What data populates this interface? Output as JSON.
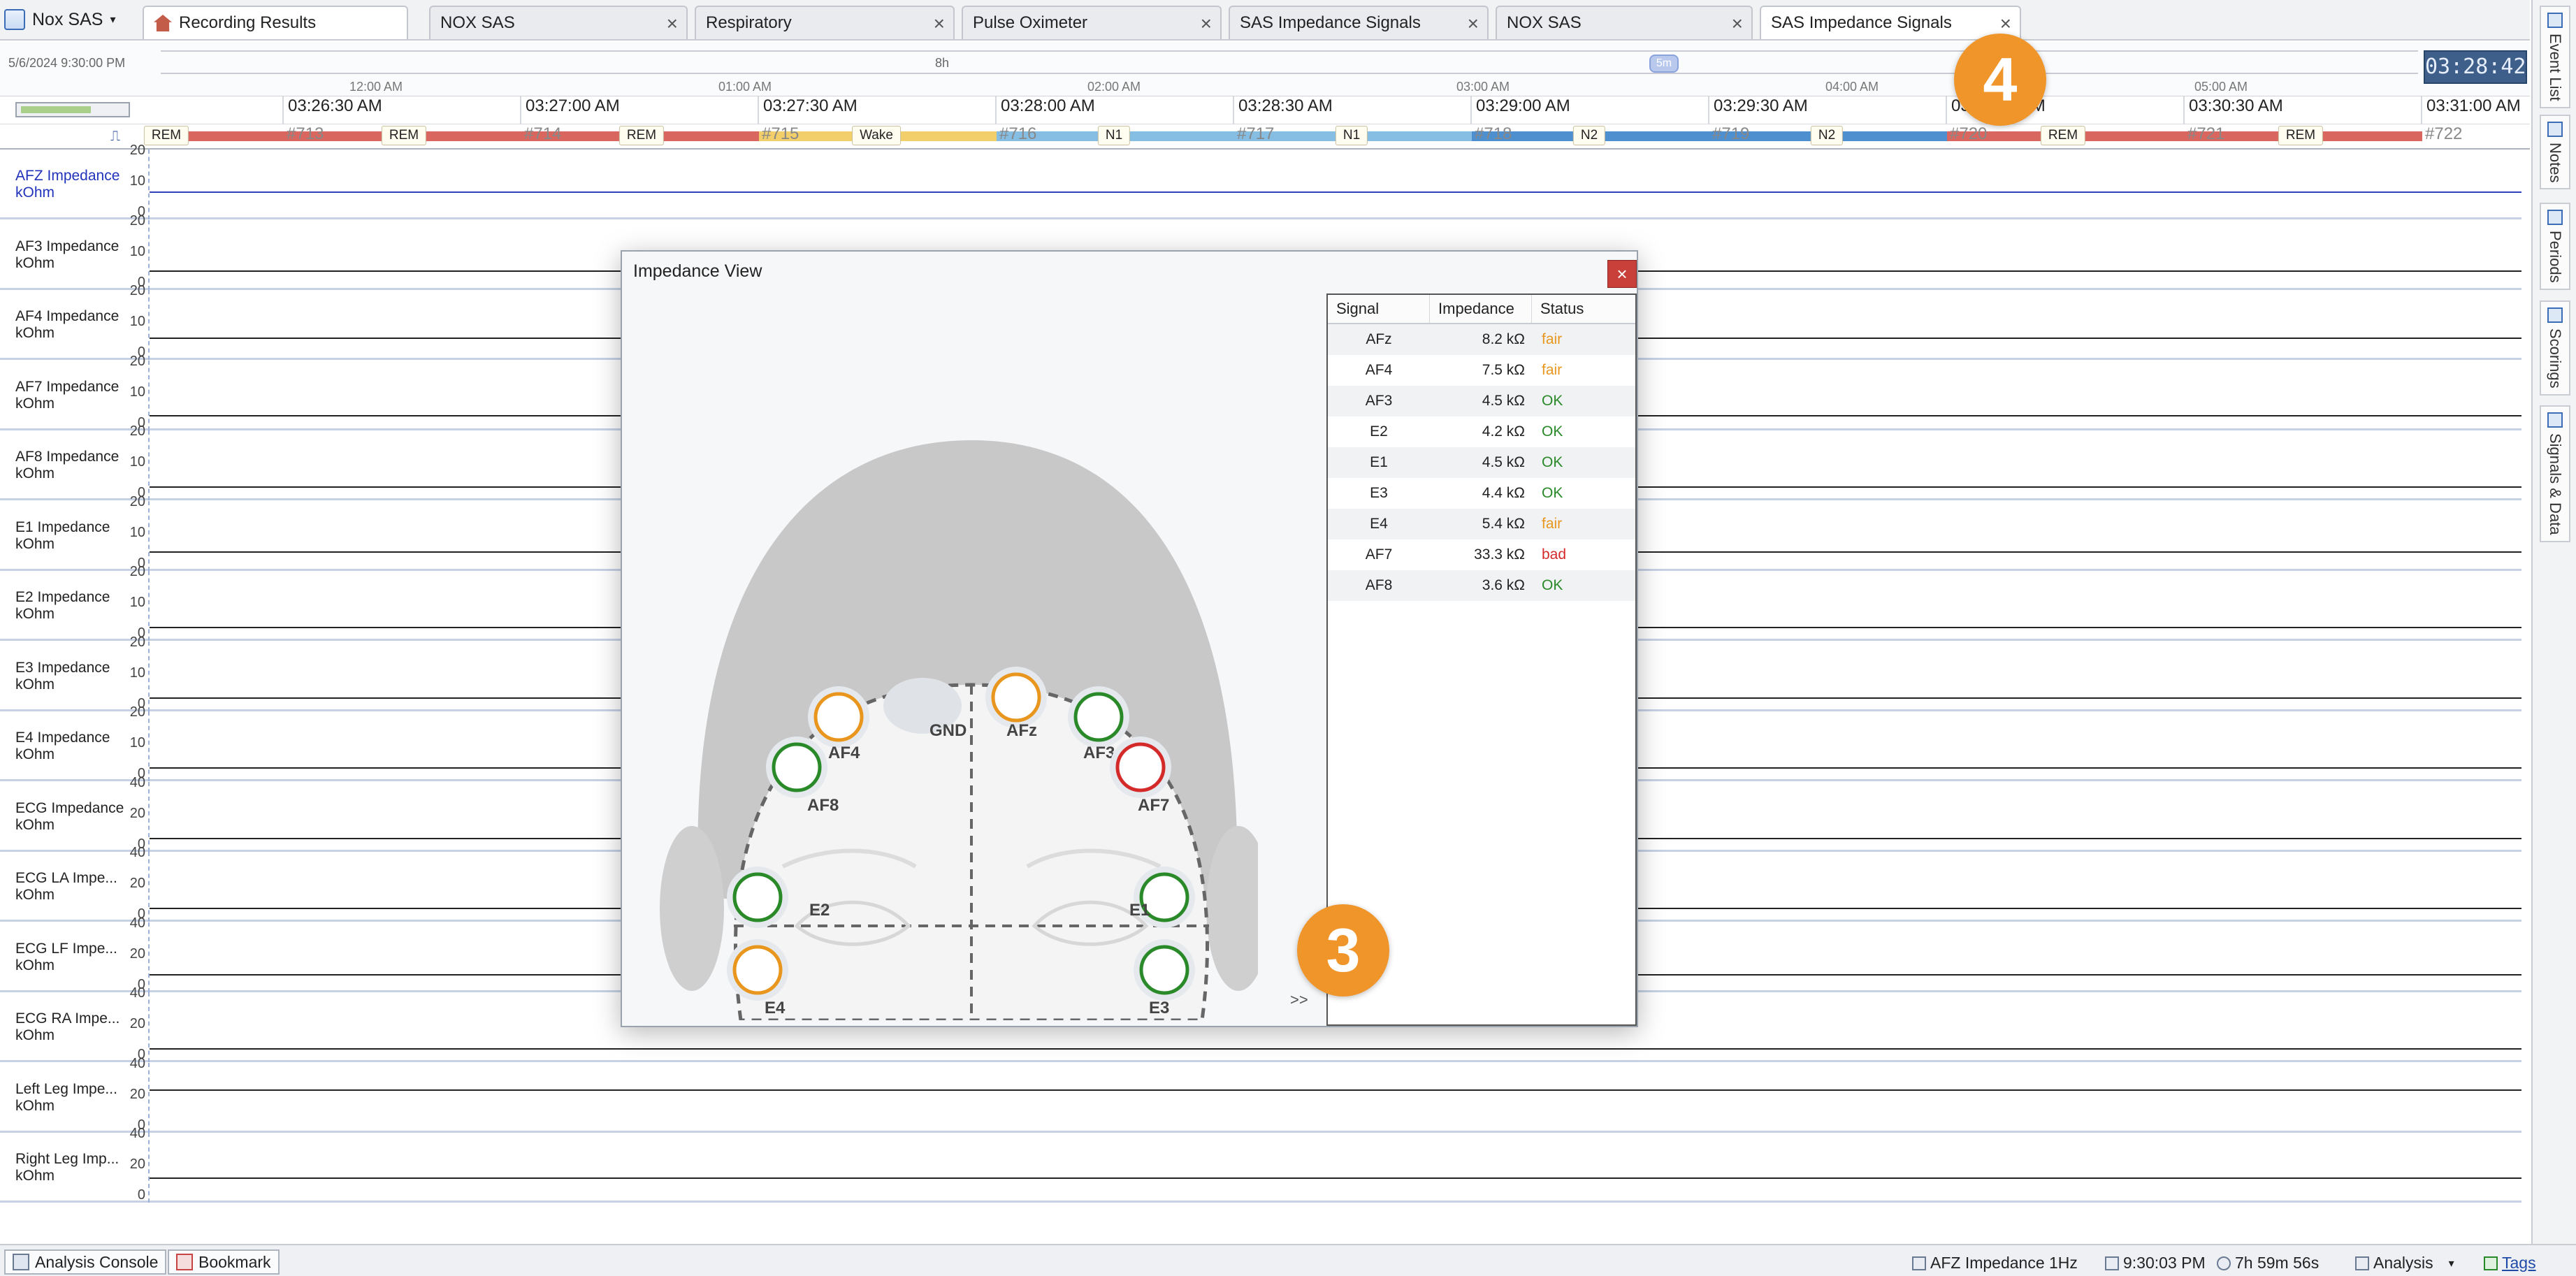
{
  "app": {
    "name": "Nox SAS"
  },
  "tabs": [
    {
      "label": "Recording Results",
      "active": true,
      "closable": false
    },
    {
      "label": "NOX SAS",
      "closable": true
    },
    {
      "label": "Respiratory",
      "closable": true
    },
    {
      "label": "Pulse Oximeter",
      "closable": true
    },
    {
      "label": "SAS Impedance Signals",
      "closable": true
    },
    {
      "label": "NOX SAS",
      "closable": true
    },
    {
      "label": "SAS Impedance Signals",
      "closable": true,
      "active_second": true
    }
  ],
  "overview": {
    "start_datetime": "5/6/2024 9:30:00 PM",
    "duration_label": "8h",
    "window_label": "5m",
    "clock": "03:28:42",
    "ticks": [
      "12:00 AM",
      "01:00 AM",
      "02:00 AM",
      "03:00 AM",
      "04:00 AM",
      "05:00 AM"
    ]
  },
  "time_axis": [
    "03:26:30 AM",
    "03:27:00 AM",
    "03:27:30 AM",
    "03:28:00 AM",
    "03:28:30 AM",
    "03:29:00 AM",
    "03:29:30 AM",
    "03:30:00 AM",
    "03:30:30 AM",
    "03:31:00 AM"
  ],
  "hypnogram": {
    "stages": [
      "REM",
      "REM",
      "REM",
      "Wake",
      "N1",
      "N1",
      "N2",
      "N2",
      "REM",
      "REM"
    ],
    "epochs": [
      "#713",
      "#714",
      "#715",
      "#716",
      "#717",
      "#718",
      "#719",
      "#720",
      "#721",
      "#722"
    ],
    "colors": {
      "REM": "#d9675f",
      "Wake": "#f2cf6b",
      "N1": "#86bde3",
      "N2": "#4d8fcf"
    }
  },
  "channels": [
    {
      "label": "AFZ Impedance kOhm",
      "scale": [
        "20",
        "10",
        "0"
      ],
      "selected": true
    },
    {
      "label": "AF3 Impedance kOhm",
      "scale": [
        "20",
        "10",
        "0"
      ]
    },
    {
      "label": "AF4 Impedance kOhm",
      "scale": [
        "20",
        "10",
        "0"
      ]
    },
    {
      "label": "AF7 Impedance kOhm",
      "scale": [
        "20",
        "10",
        "0"
      ]
    },
    {
      "label": "AF8 Impedance kOhm",
      "scale": [
        "20",
        "10",
        "0"
      ]
    },
    {
      "label": "E1 Impedance kOhm",
      "scale": [
        "20",
        "10",
        "0"
      ]
    },
    {
      "label": "E2 Impedance kOhm",
      "scale": [
        "20",
        "10",
        "0"
      ]
    },
    {
      "label": "E3 Impedance kOhm",
      "scale": [
        "20",
        "10",
        "0"
      ]
    },
    {
      "label": "E4 Impedance kOhm",
      "scale": [
        "20",
        "10",
        "0"
      ]
    },
    {
      "label": "ECG Impedance kOhm",
      "scale": [
        "40",
        "20",
        "0"
      ]
    },
    {
      "label": "ECG LA Impe... kOhm",
      "scale": [
        "40",
        "20",
        "0"
      ]
    },
    {
      "label": "ECG LF Impe... kOhm",
      "scale": [
        "40",
        "20",
        "0"
      ]
    },
    {
      "label": "ECG RA Impe... kOhm",
      "scale": [
        "40",
        "20",
        "0"
      ]
    },
    {
      "label": "Left Leg Impe... kOhm",
      "scale": [
        "40",
        "20",
        "0"
      ]
    },
    {
      "label": "Right Leg Imp... kOhm",
      "scale": [
        "40",
        "20",
        "0"
      ]
    }
  ],
  "sidebar": [
    "Event List",
    "Notes",
    "Periods",
    "Scorings",
    "Signals & Data"
  ],
  "statusbar": {
    "analysis_console": "Analysis Console",
    "bookmark": "Bookmark",
    "signal": "AFZ Impedance 1Hz",
    "time": "9:30:03 PM",
    "duration": "7h 59m 56s",
    "mode": "Analysis",
    "tags": "Tags"
  },
  "dialog": {
    "title": "Impedance View",
    "close": "×",
    "more": ">>",
    "table_headers": [
      "Signal",
      "Impedance",
      "Status"
    ],
    "rows": [
      {
        "signal": "AFz",
        "impedance": "8.2 kΩ",
        "status": "fair"
      },
      {
        "signal": "AF4",
        "impedance": "7.5 kΩ",
        "status": "fair"
      },
      {
        "signal": "AF3",
        "impedance": "4.5 kΩ",
        "status": "OK"
      },
      {
        "signal": "E2",
        "impedance": "4.2 kΩ",
        "status": "OK"
      },
      {
        "signal": "E1",
        "impedance": "4.5 kΩ",
        "status": "OK"
      },
      {
        "signal": "E3",
        "impedance": "4.4 kΩ",
        "status": "OK"
      },
      {
        "signal": "E4",
        "impedance": "5.4 kΩ",
        "status": "fair"
      },
      {
        "signal": "AF7",
        "impedance": "33.3 kΩ",
        "status": "bad"
      },
      {
        "signal": "AF8",
        "impedance": "3.6 kΩ",
        "status": "OK"
      }
    ],
    "electrodes": [
      {
        "label": "AF4",
        "status": "fair"
      },
      {
        "label": "GND",
        "status": "none"
      },
      {
        "label": "AFz",
        "status": "fair"
      },
      {
        "label": "AF3",
        "status": "OK"
      },
      {
        "label": "AF8",
        "status": "OK"
      },
      {
        "label": "AF7",
        "status": "bad"
      },
      {
        "label": "E2",
        "status": "OK"
      },
      {
        "label": "E1",
        "status": "OK"
      },
      {
        "label": "E4",
        "status": "fair"
      },
      {
        "label": "E3",
        "status": "OK"
      }
    ],
    "status_colors": {
      "OK": "#2a8a2a",
      "fair": "#e8961e",
      "bad": "#d42a2a"
    }
  },
  "callouts": [
    "3",
    "4"
  ]
}
